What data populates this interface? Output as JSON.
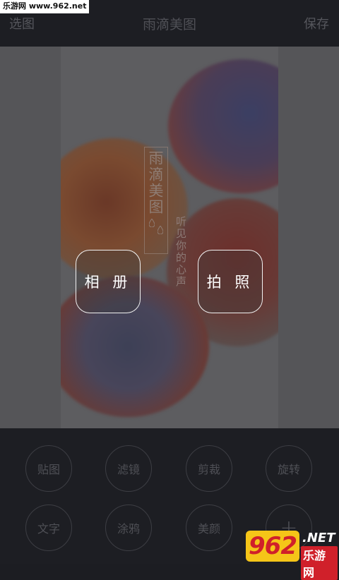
{
  "watermark": {
    "text": "乐游网 www.962.net"
  },
  "header": {
    "left_button": "选图",
    "title": "雨滴美图",
    "right_button": "保存"
  },
  "poster": {
    "vertical_title": "雨滴美图",
    "vertical_subtitle": "听见你的心声"
  },
  "actions": {
    "album": "相 册",
    "camera": "拍 照"
  },
  "tools": [
    {
      "label": "贴图"
    },
    {
      "label": "滤镜"
    },
    {
      "label": "剪裁"
    },
    {
      "label": "旋转"
    },
    {
      "label": "文字"
    },
    {
      "label": "涂鸦"
    },
    {
      "label": "美颜"
    },
    {
      "label": "+"
    }
  ],
  "logo": {
    "number": "962",
    "suffix": ".NET",
    "name": "乐游网"
  },
  "colors": {
    "background": "#1c1d22",
    "bar_text": "#55565c",
    "button_border": "#f2f2f2",
    "logo_yellow": "#f5c518",
    "logo_red": "#d0202a"
  }
}
